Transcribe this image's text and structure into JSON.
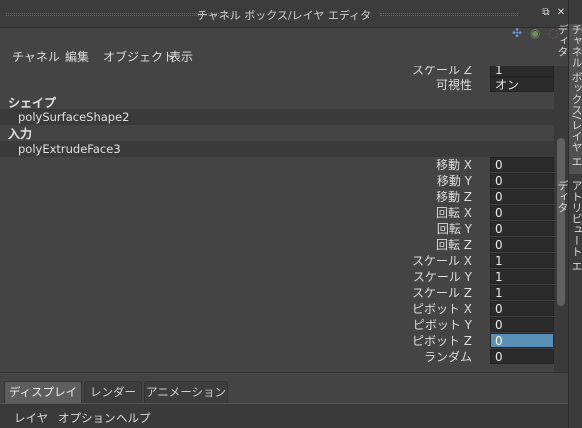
{
  "window": {
    "title": "チャネル ボックス/レイヤ エディタ",
    "float_glyph": "⧉",
    "close_glyph": "✕"
  },
  "menu": {
    "channel": "チャネル",
    "edit": "編集",
    "object": "オブジェクト",
    "show": "表示"
  },
  "top_icons": {
    "axis": "✣",
    "circle1": "◉",
    "circle2": "◌"
  },
  "partial_row": {
    "label": "スケール Z",
    "value": "1"
  },
  "visibility_row": {
    "label": "可視性",
    "value": "オン"
  },
  "shape_section": {
    "title": "シェイプ",
    "node": "polySurfaceShape2"
  },
  "input_section": {
    "title": "入力",
    "node": "polyExtrudeFace3"
  },
  "attributes": [
    {
      "label": "移動 X",
      "value": "0"
    },
    {
      "label": "移動 Y",
      "value": "0"
    },
    {
      "label": "移動 Z",
      "value": "0"
    },
    {
      "label": "回転 X",
      "value": "0"
    },
    {
      "label": "回転 Y",
      "value": "0"
    },
    {
      "label": "回転 Z",
      "value": "0"
    },
    {
      "label": "スケール X",
      "value": "1"
    },
    {
      "label": "スケール Y",
      "value": "1"
    },
    {
      "label": "スケール Z",
      "value": "1"
    },
    {
      "label": "ピボット X",
      "value": "0"
    },
    {
      "label": "ピボット Y",
      "value": "0"
    },
    {
      "label": "ピボット Z",
      "value": "0"
    },
    {
      "label": "ランダム",
      "value": "0"
    }
  ],
  "side_tabs": {
    "channel_box": "チャネル ボックス/レイヤ エディタ",
    "attribute_editor": "アトリビュート エディタ"
  },
  "bottom_tabs": {
    "display": "ディスプレイ",
    "render": "レンダー",
    "animation": "アニメーション"
  },
  "layer_menu": {
    "layer": "レイヤ",
    "options": "オプション",
    "help": "ヘルプ"
  },
  "colors": {
    "selection": "#5a8fb8",
    "panel": "#444444"
  }
}
